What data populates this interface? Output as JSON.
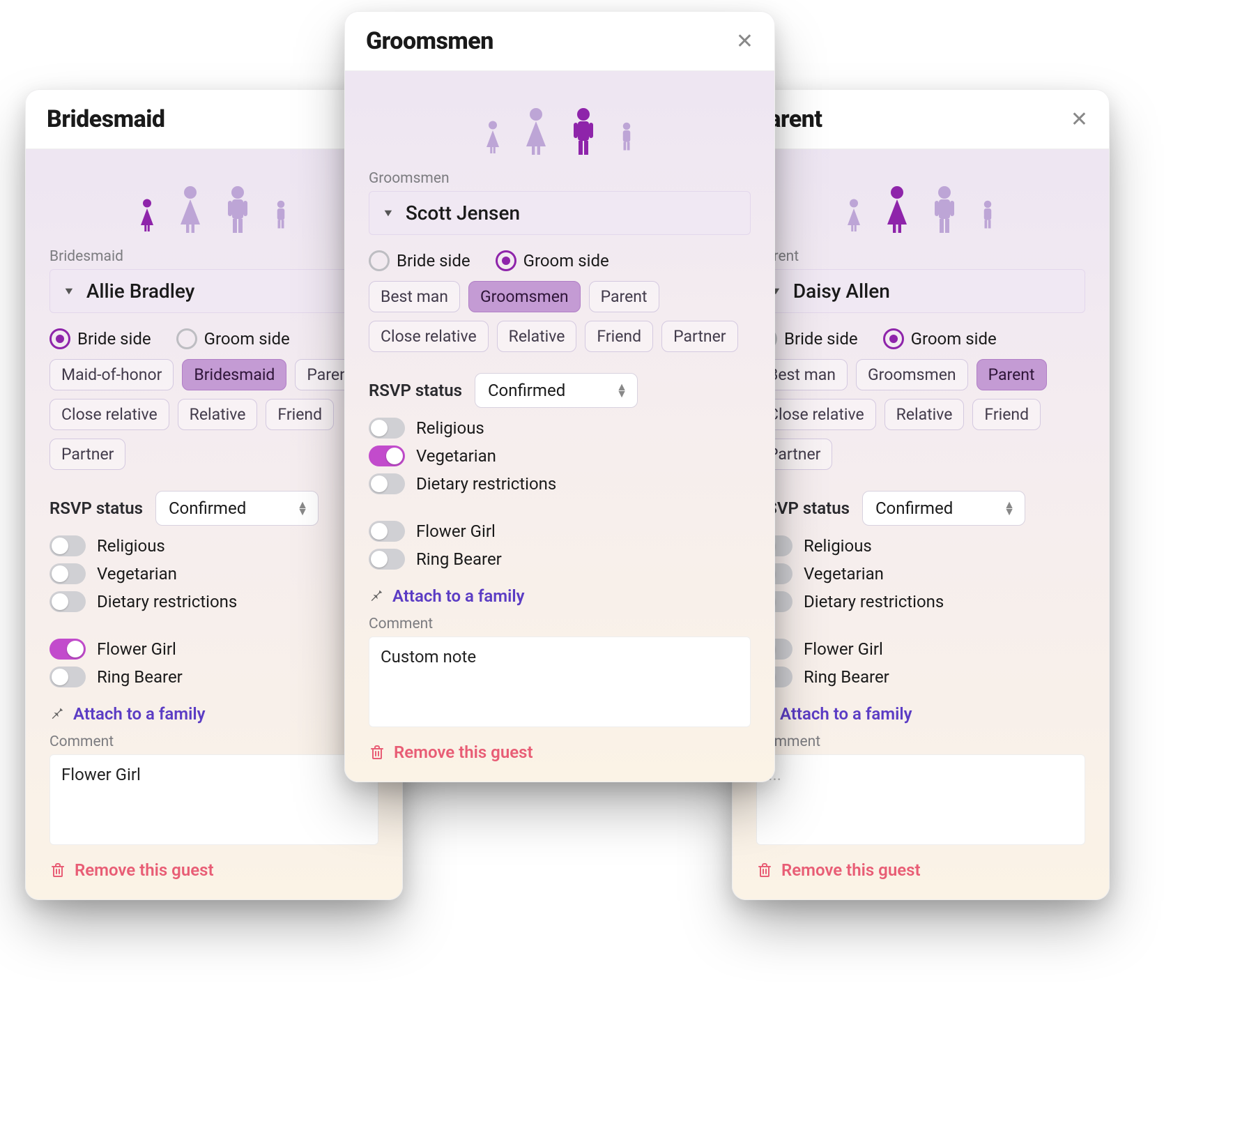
{
  "common": {
    "radio_bride": "Bride side",
    "radio_groom": "Groom side",
    "rsvp_label": "RSVP status",
    "rsvp_value": "Confirmed",
    "toggle_religious": "Religious",
    "toggle_vegetarian": "Vegetarian",
    "toggle_dietary": "Dietary restrictions",
    "toggle_flowergirl": "Flower Girl",
    "toggle_ringbearer": "Ring Bearer",
    "attach_label": "Attach to a family",
    "comment_label": "Comment",
    "remove_label": "Remove this guest",
    "comment_placeholder": "..."
  },
  "cards": {
    "left": {
      "title": "Bridesmaid",
      "role_label": "Bridesmaid",
      "name": "Allie Bradley",
      "person_type": "girl",
      "side": "bride",
      "role_options": [
        "Maid-of-honor",
        "Bridesmaid",
        "Parent",
        "Close relative",
        "Relative",
        "Friend",
        "Partner"
      ],
      "role_selected": "Bridesmaid",
      "toggles": {
        "religious": false,
        "vegetarian": false,
        "dietary": false,
        "flowergirl": true,
        "ringbearer": false
      },
      "comment": "Flower Girl",
      "show_bouquet": true
    },
    "center": {
      "title": "Groomsmen",
      "role_label": "Groomsmen",
      "name": "Scott Jensen",
      "person_type": "man",
      "side": "groom",
      "role_options": [
        "Best man",
        "Groomsmen",
        "Parent",
        "Close relative",
        "Relative",
        "Friend",
        "Partner"
      ],
      "role_selected": "Groomsmen",
      "toggles": {
        "religious": false,
        "vegetarian": true,
        "dietary": false,
        "flowergirl": false,
        "ringbearer": false
      },
      "comment": "Custom note",
      "show_bouquet": false
    },
    "right": {
      "title": "Parent",
      "role_label": "Parent",
      "name": "Daisy Allen",
      "person_type": "woman",
      "side": "groom",
      "role_options": [
        "Best man",
        "Groomsmen",
        "Parent",
        "Close relative",
        "Relative",
        "Friend",
        "Partner"
      ],
      "role_selected": "Parent",
      "toggles": {
        "religious": false,
        "vegetarian": false,
        "dietary": false,
        "flowergirl": false,
        "ringbearer": false
      },
      "comment": "",
      "show_bouquet": false
    }
  }
}
